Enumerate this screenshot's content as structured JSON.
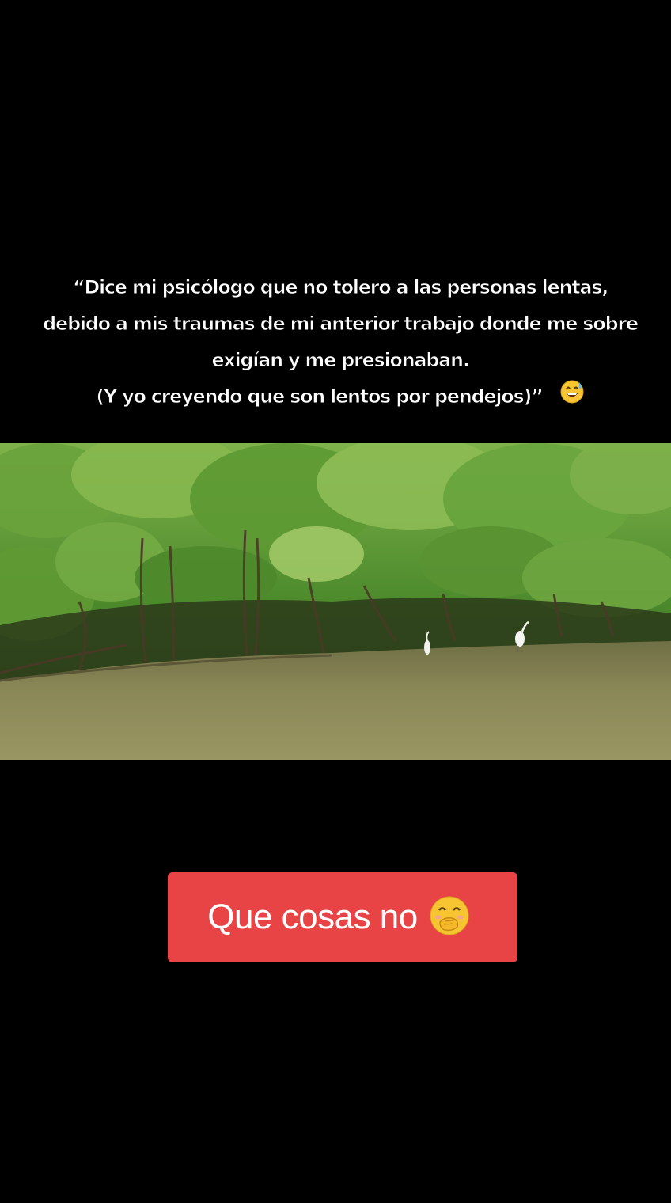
{
  "caption": {
    "line1": "“Dice mi psicólogo que no tolero a las personas lentas,",
    "line2": "debido a mis traumas de mi anterior trabajo donde me sobre",
    "line3": "exigían y me presionaban.",
    "line4": "(Y yo creyendo que son lentos por pendejos)”",
    "line4_emoji": "grinning-face-with-sweat-icon"
  },
  "sticker": {
    "text": "Que cosas no",
    "emoji": "face-with-hand-over-mouth-icon",
    "color": "#e84345"
  },
  "photo": {
    "scene": "mangrove-river",
    "colors": {
      "foliage": "#4f8a2c",
      "water": "#8c8a5a"
    }
  }
}
